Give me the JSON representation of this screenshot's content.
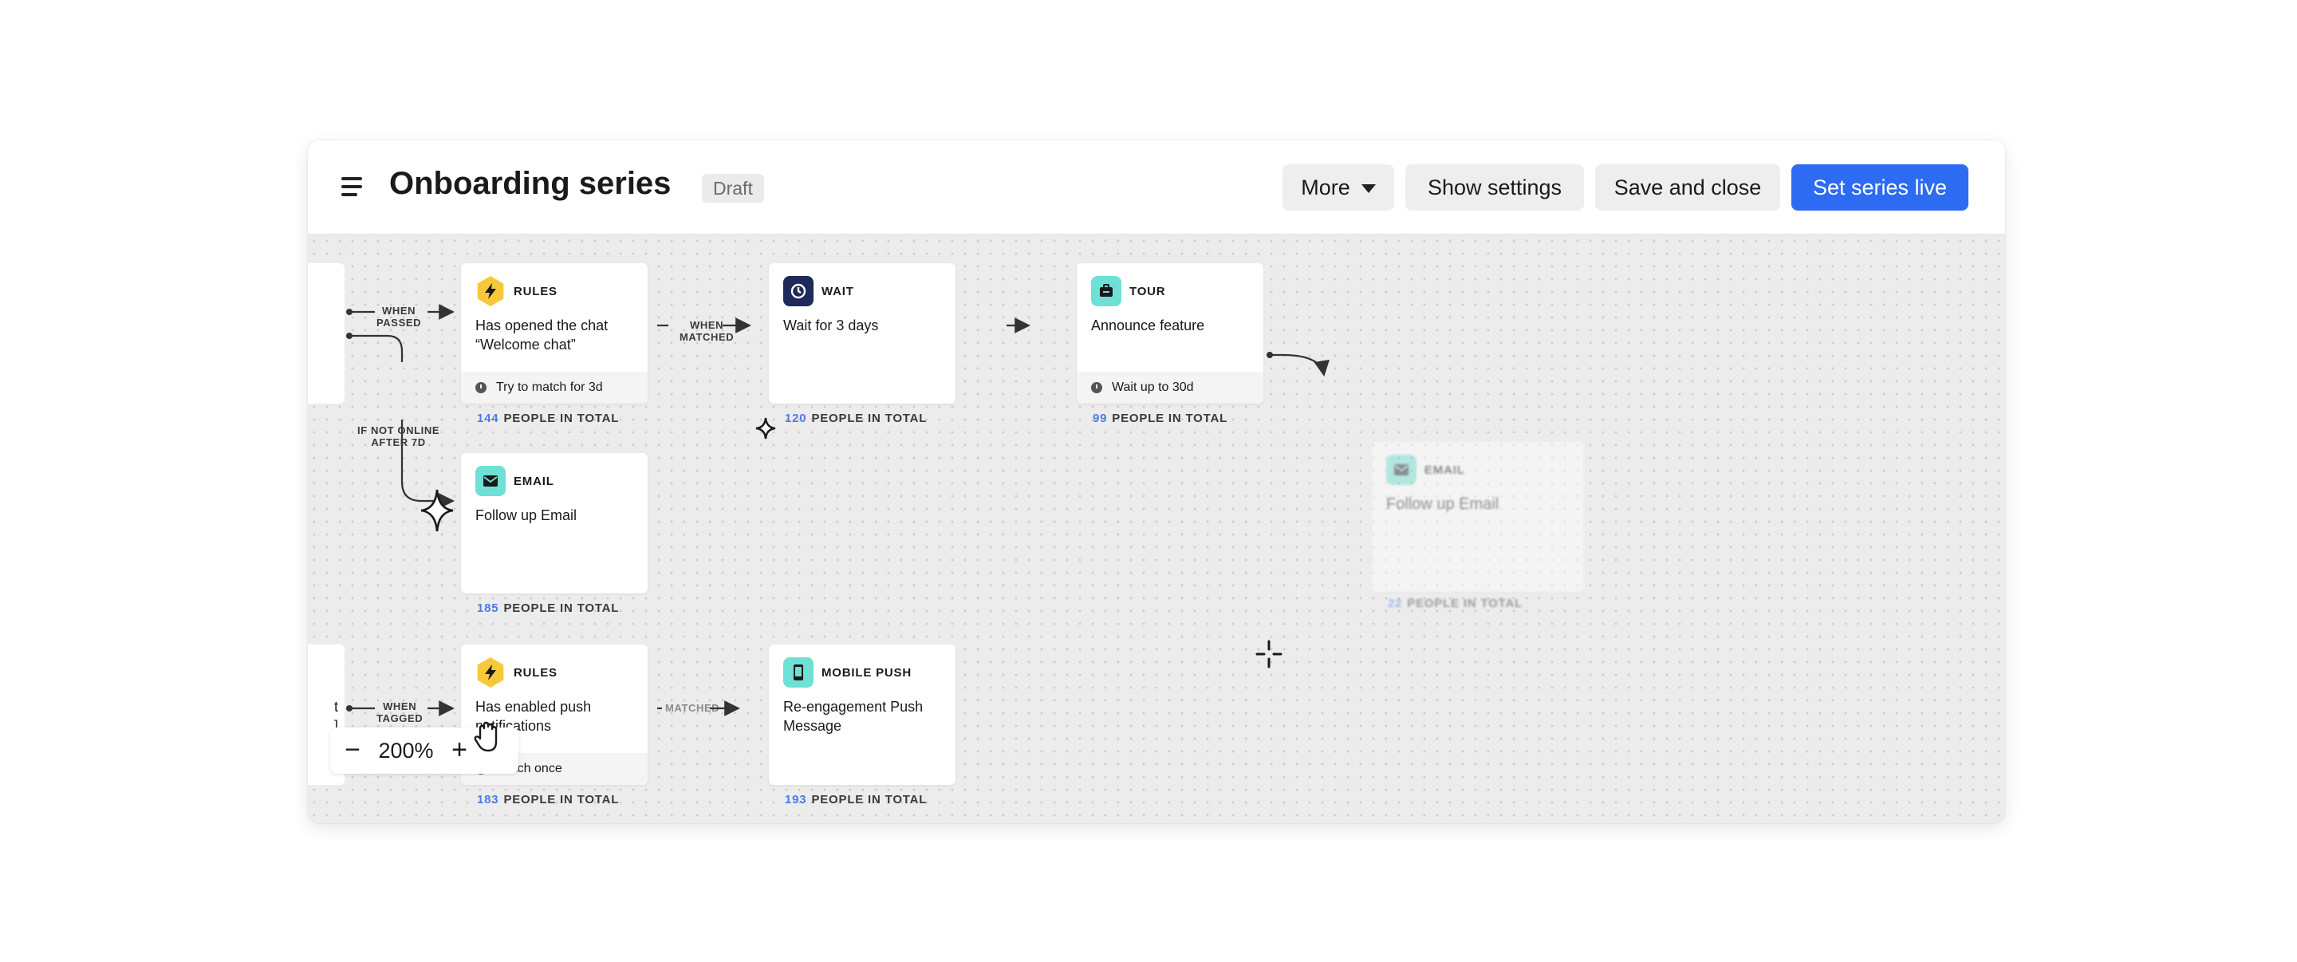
{
  "header": {
    "title": "Onboarding series",
    "status": "Draft",
    "buttons": {
      "more": "More",
      "show_settings": "Show settings",
      "save_close": "Save and close",
      "set_live": "Set series live"
    }
  },
  "connectors": {
    "when_passed": [
      "WHEN",
      "PASSED"
    ],
    "if_not_online": [
      "IF NOT ONLINE",
      "AFTER 7D"
    ],
    "when_matched": [
      "WHEN",
      "MATCHED"
    ],
    "when_tagged": [
      "WHEN",
      "TAGGED"
    ],
    "matched_short": "MATCHED"
  },
  "partial_card": {
    "text_line1": "t",
    "text_line2": "]"
  },
  "cards": {
    "rules1": {
      "type": "RULES",
      "text": "Has opened the chat “Welcome chat”",
      "foot": "Try to match for 3d",
      "people": "144",
      "people_label": "PEOPLE IN TOTAL"
    },
    "wait": {
      "type": "WAIT",
      "text": "Wait for 3 days",
      "people": "120",
      "people_label": "PEOPLE IN TOTAL"
    },
    "tour": {
      "type": "TOUR",
      "text": "Announce feature",
      "foot": "Wait up to 30d",
      "people": "99",
      "people_label": "PEOPLE IN TOTAL"
    },
    "email1": {
      "type": "EMAIL",
      "text": "Follow up Email",
      "people": "185",
      "people_label": "PEOPLE IN TOTAL"
    },
    "email_ghost": {
      "type": "EMAIL",
      "text": "Follow up Email",
      "people": "22",
      "people_label": "PEOPLE IN TOTAL"
    },
    "rules2": {
      "type": "RULES",
      "text": "Has enabled push notifications",
      "foot": "Match once",
      "people": "183",
      "people_label": "PEOPLE IN TOTAL"
    },
    "push": {
      "type": "MOBILE PUSH",
      "text": "Re-engagement Push Message",
      "people": "193",
      "people_label": "PEOPLE IN TOTAL"
    }
  },
  "zoom": {
    "level": "200%",
    "minus": "−",
    "plus": "+"
  },
  "colors": {
    "primary": "#2c6bf2",
    "count": "#4a7be5",
    "rules": "#f7c83a",
    "wait": "#1e2a5a",
    "teal": "#6fe0d5"
  }
}
